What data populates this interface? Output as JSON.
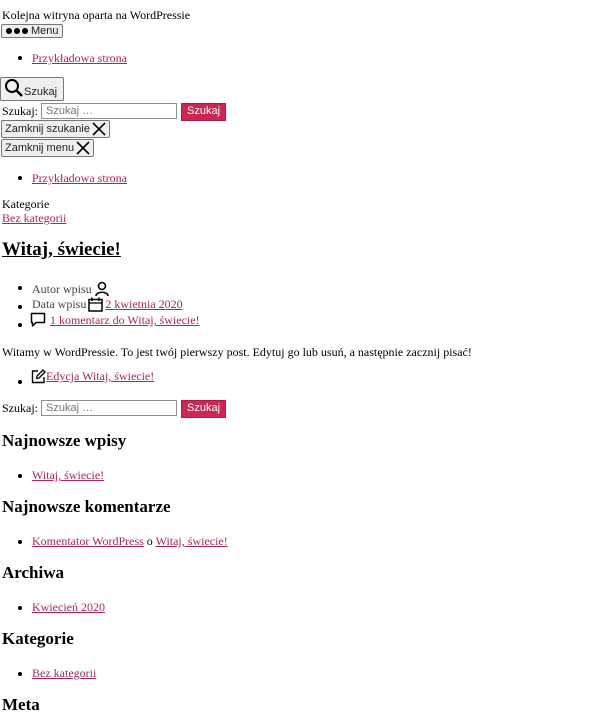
{
  "header": {
    "tagline": "Kolejna witryna oparta na WordPressie",
    "menu_button": "Menu",
    "search_toggle": "Szukaj"
  },
  "nav": {
    "items": [
      {
        "label": "Przykładowa strona"
      }
    ]
  },
  "search_modal": {
    "label": "Szukaj:",
    "placeholder": "Szukaj …",
    "submit": "Szukaj",
    "close": "Zamknij szukanie"
  },
  "menu_modal": {
    "close": "Zamknij menu",
    "items": [
      {
        "label": "Przykładowa strona"
      }
    ]
  },
  "post": {
    "categories_label": "Kategorie",
    "category": "Bez kategorii",
    "title": "Witaj, świecie!",
    "meta": {
      "author_label": "Autor wpisu",
      "date_label": "Data wpisu",
      "date": "2 kwietnia 2020",
      "comments": "1 komentarz do Witaj, świecie!"
    },
    "content": "Witamy w WordPressie. To jest twój pierwszy post. Edytuj go lub usuń, a następnie zacznij pisać!",
    "edit_link": "Edycja Witaj, świecie!"
  },
  "footer_search": {
    "label": "Szukaj:",
    "placeholder": "Szukaj …",
    "submit": "Szukaj"
  },
  "widgets": {
    "recent_posts": {
      "title": "Najnowsze wpisy",
      "items": [
        "Witaj, świecie!"
      ]
    },
    "recent_comments": {
      "title": "Najnowsze komentarze",
      "author": "Komentator WordPress",
      "connector": "o",
      "post": "Witaj, świecie!"
    },
    "archives": {
      "title": "Archiwa",
      "items": [
        "Kwiecień 2020"
      ]
    },
    "categories": {
      "title": "Kategorie",
      "items": [
        "Bez kategorii"
      ]
    },
    "meta": {
      "title": "Meta"
    }
  },
  "colors": {
    "link": "#b0245a",
    "button_accent": "#cd2653"
  },
  "icons": [
    "dots-icon",
    "search-icon",
    "close-icon",
    "user-icon",
    "calendar-icon",
    "comment-icon",
    "edit-icon"
  ]
}
